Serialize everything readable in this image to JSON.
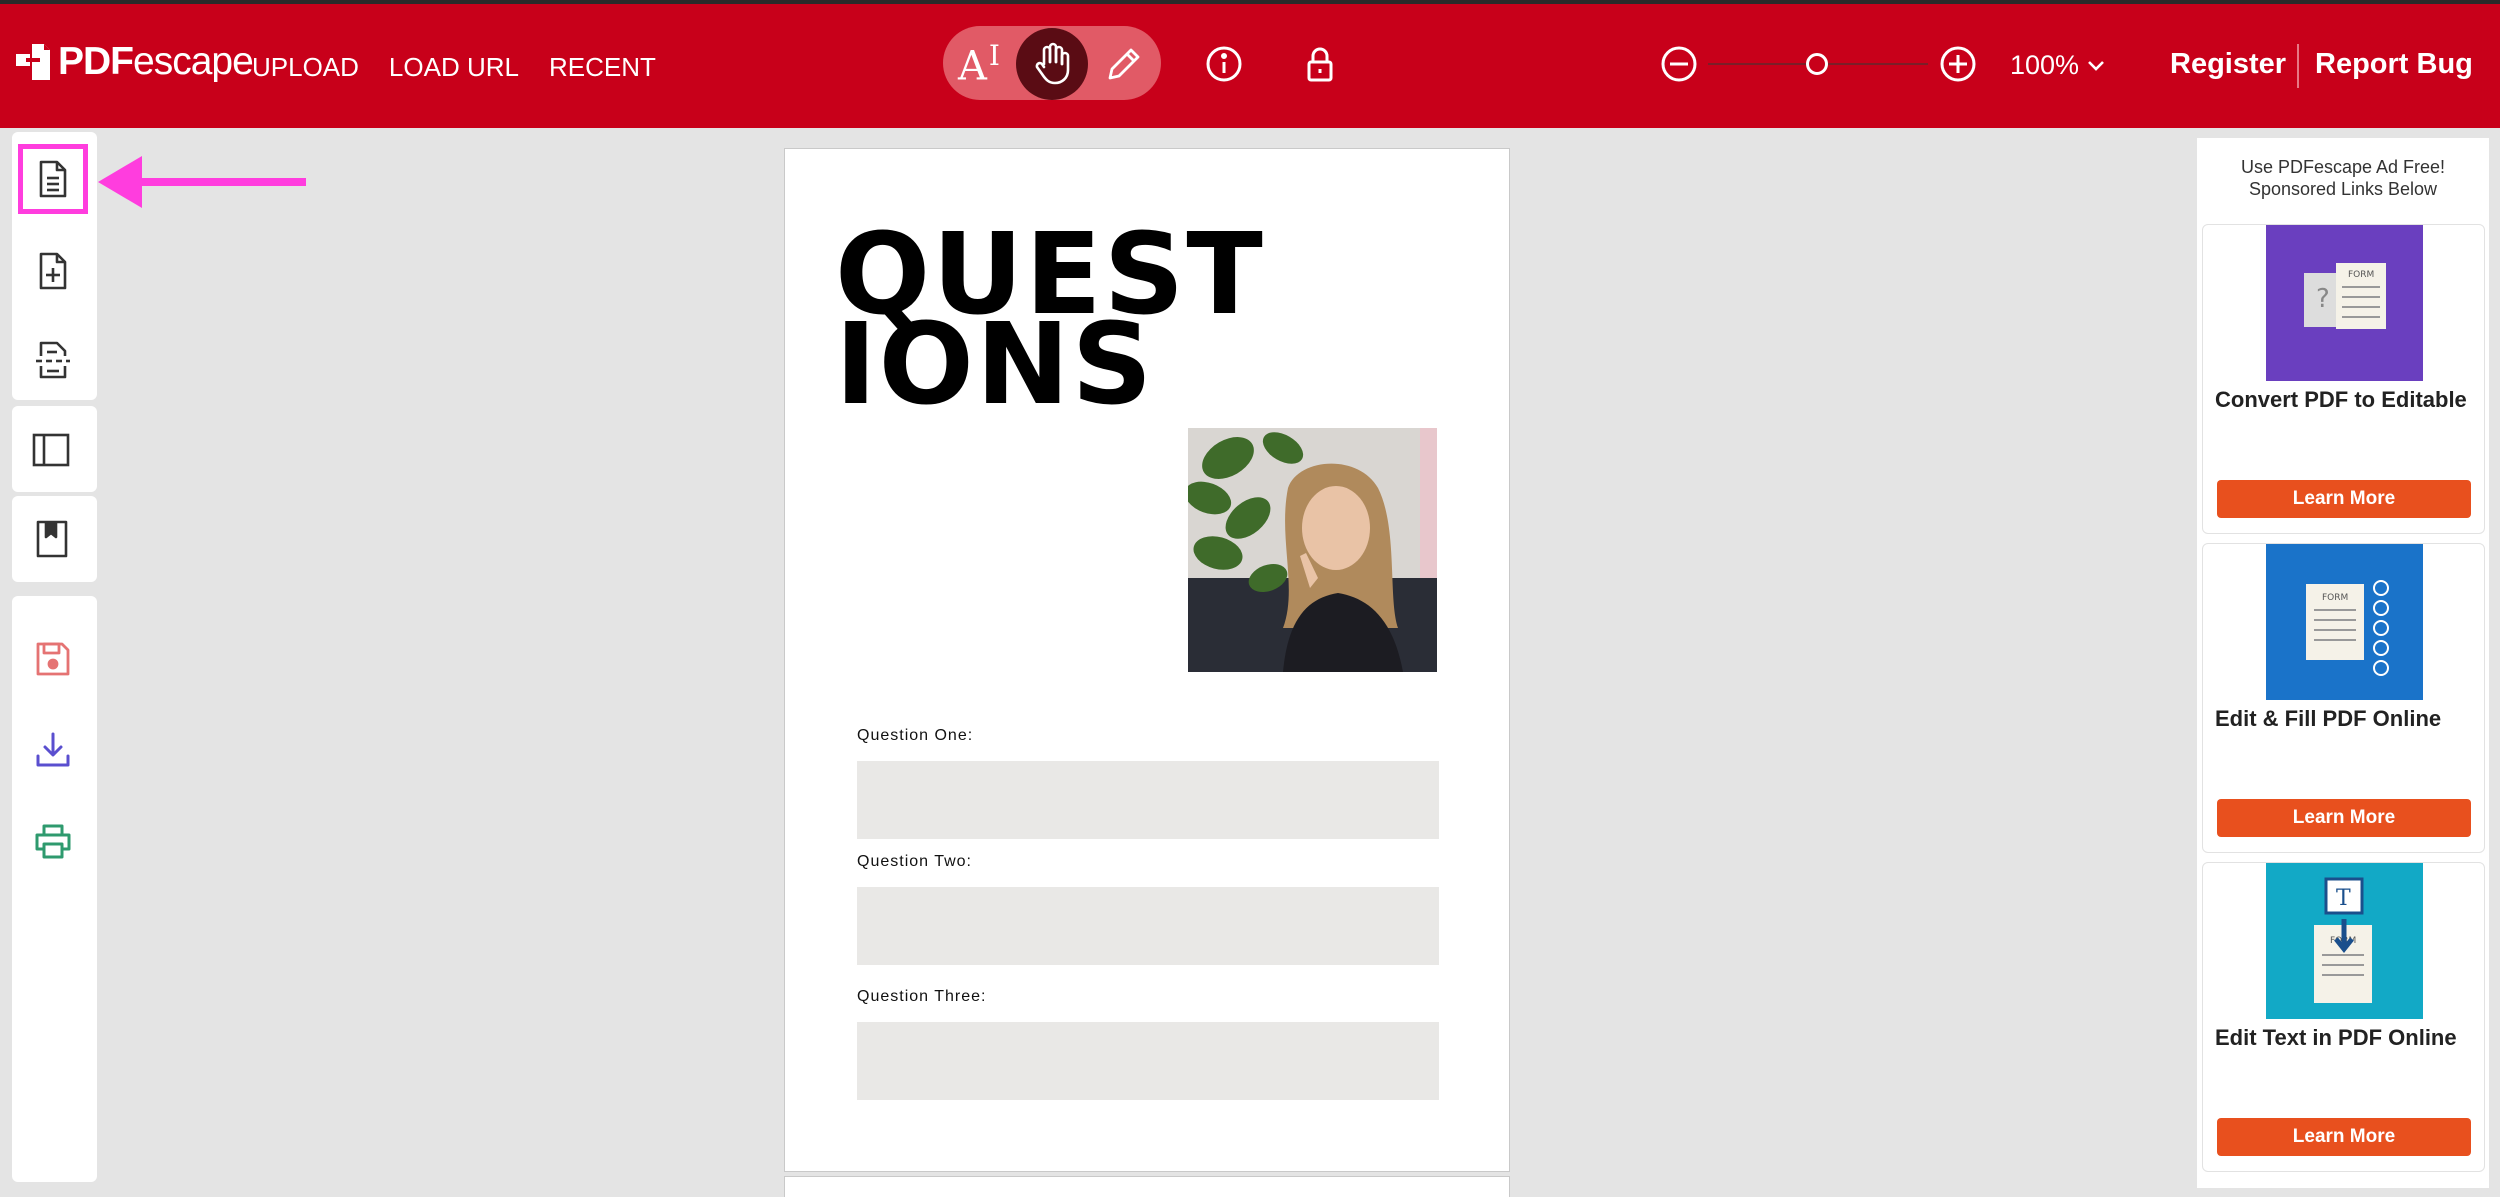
{
  "app": {
    "logo_text_bold": "PDF",
    "logo_text_light": "escape"
  },
  "nav": {
    "upload": "UPLOAD",
    "load_url": "LOAD URL",
    "recent": "RECENT"
  },
  "toolbar": {
    "text_tool_glyph": "A",
    "text_tool_cursor": "I",
    "active_tool": "hand",
    "zoom_level": "100%",
    "zoom_fraction": 0.5
  },
  "header_right": {
    "register": "Register",
    "report_bug": "Report Bug"
  },
  "sidebar": {
    "items": [
      {
        "name": "document-icon",
        "highlighted": true
      },
      {
        "name": "add-page-icon"
      },
      {
        "name": "split-page-icon"
      },
      {
        "name": "panel-icon"
      },
      {
        "name": "bookmark-icon"
      },
      {
        "name": "save-icon",
        "color": "#e57373"
      },
      {
        "name": "download-icon",
        "color": "#5a4fcf"
      },
      {
        "name": "print-icon",
        "color": "#2e9a6e"
      }
    ],
    "highlight_color": "#ff3dde"
  },
  "document": {
    "title_line1": "QUEST",
    "title_line2": "IONS",
    "questions": [
      {
        "label": "Question One:"
      },
      {
        "label": "Question Two:"
      },
      {
        "label": "Question Three:"
      }
    ]
  },
  "ads": {
    "note_line1": "Use PDFescape Ad Free!",
    "note_line2": "Sponsored Links Below",
    "cards": [
      {
        "title": "Convert PDF to Editable",
        "button": "Learn More",
        "bg": "#6a3fbf"
      },
      {
        "title": "Edit & Fill PDF Online",
        "button": "Learn More",
        "bg": "#1a73c9"
      },
      {
        "title": "Edit Text in PDF Online",
        "button": "Learn More",
        "bg": "#12a9c6"
      }
    ],
    "button_color": "#e8501e"
  },
  "colors": {
    "header_bg": "#c8001a",
    "canvas_bg": "#e4e4e4"
  }
}
